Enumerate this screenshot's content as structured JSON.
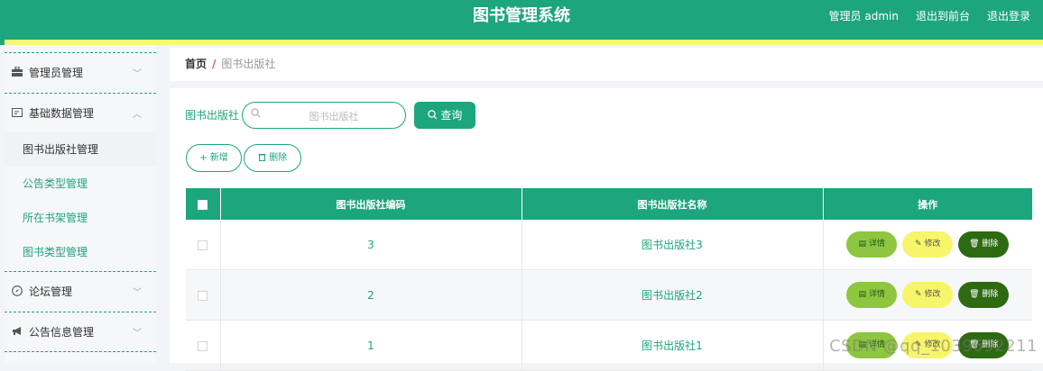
{
  "header": {
    "title": "图书管理系统",
    "user": "管理员 admin",
    "front_link": "退出到前台",
    "logout": "退出登录"
  },
  "sidebar": {
    "groups": [
      {
        "label": "管理员管理",
        "icon": "briefcase-icon",
        "chevron": "﹀"
      },
      {
        "label": "基础数据管理",
        "icon": "id-card-icon",
        "chevron": "︿"
      },
      {
        "label": "论坛管理",
        "icon": "compass-icon",
        "chevron": "﹀"
      },
      {
        "label": "公告信息管理",
        "icon": "megaphone-icon",
        "chevron": "﹀"
      }
    ],
    "sub_items": [
      "图书出版社管理",
      "公告类型管理",
      "所在书架管理",
      "图书类型管理"
    ]
  },
  "breadcrumb": {
    "home": "首页",
    "separator": "/",
    "current": "图书出版社"
  },
  "search": {
    "label": "图书出版社",
    "placeholder": "图书出版社",
    "button": "查询"
  },
  "actions": {
    "add": "新增",
    "delete": "删除"
  },
  "table": {
    "columns": [
      "图书出版社编码",
      "图书出版社名称",
      "操作"
    ],
    "rows": [
      {
        "code": "3",
        "name": "图书出版社3"
      },
      {
        "code": "2",
        "name": "图书出版社2"
      },
      {
        "code": "1",
        "name": "图书出版社1"
      }
    ],
    "row_actions": {
      "detail": "详情",
      "edit": "修改",
      "delete": "删除"
    }
  },
  "watermark": "CSDN @qq_1039692211",
  "colors": {
    "primary": "#1da67e",
    "accent_yellow": "#f5f87a",
    "detail": "#8ec63f",
    "edit": "#f7f56a",
    "delete": "#2d6a12"
  }
}
